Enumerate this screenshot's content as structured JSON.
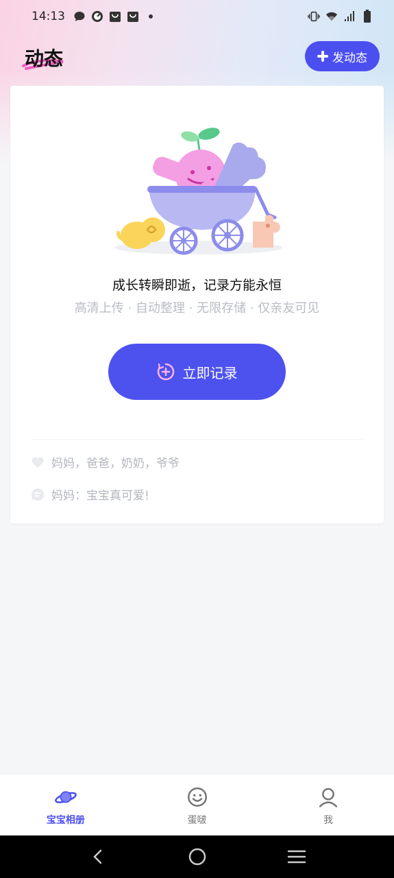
{
  "status_bar": {
    "time": "14:13",
    "left_icons": [
      "chat-bubble-icon",
      "gauge-icon",
      "bag-icon",
      "bag-icon",
      "dot-icon"
    ],
    "right_icons": [
      "vibrate-icon",
      "wifi-icon",
      "signal-icon",
      "battery-icon"
    ]
  },
  "header": {
    "title": "动态",
    "post_button_label": "发动态"
  },
  "empty_state": {
    "headline": "成长转瞬即逝，记录方能永恒",
    "subline": "高清上传 · 自动整理 · 无限存储 · 仅亲友可见",
    "record_button_label": "立即记录"
  },
  "social": {
    "likes": "妈妈，爸爸，奶奶，爷爷",
    "comment": "妈妈：宝宝真可爱!"
  },
  "tabs": [
    {
      "label": "宝宝相册",
      "icon": "planet-icon",
      "active": true
    },
    {
      "label": "蛋啵",
      "icon": "smiley-icon",
      "active": false
    },
    {
      "label": "我",
      "icon": "person-icon",
      "active": false
    }
  ],
  "nav": {
    "buttons": [
      "back-icon",
      "home-icon",
      "menu-icon"
    ]
  },
  "colors": {
    "accent": "#4b4ff0",
    "muted_text": "#b9bcc4",
    "background": "#f5f6f8"
  }
}
